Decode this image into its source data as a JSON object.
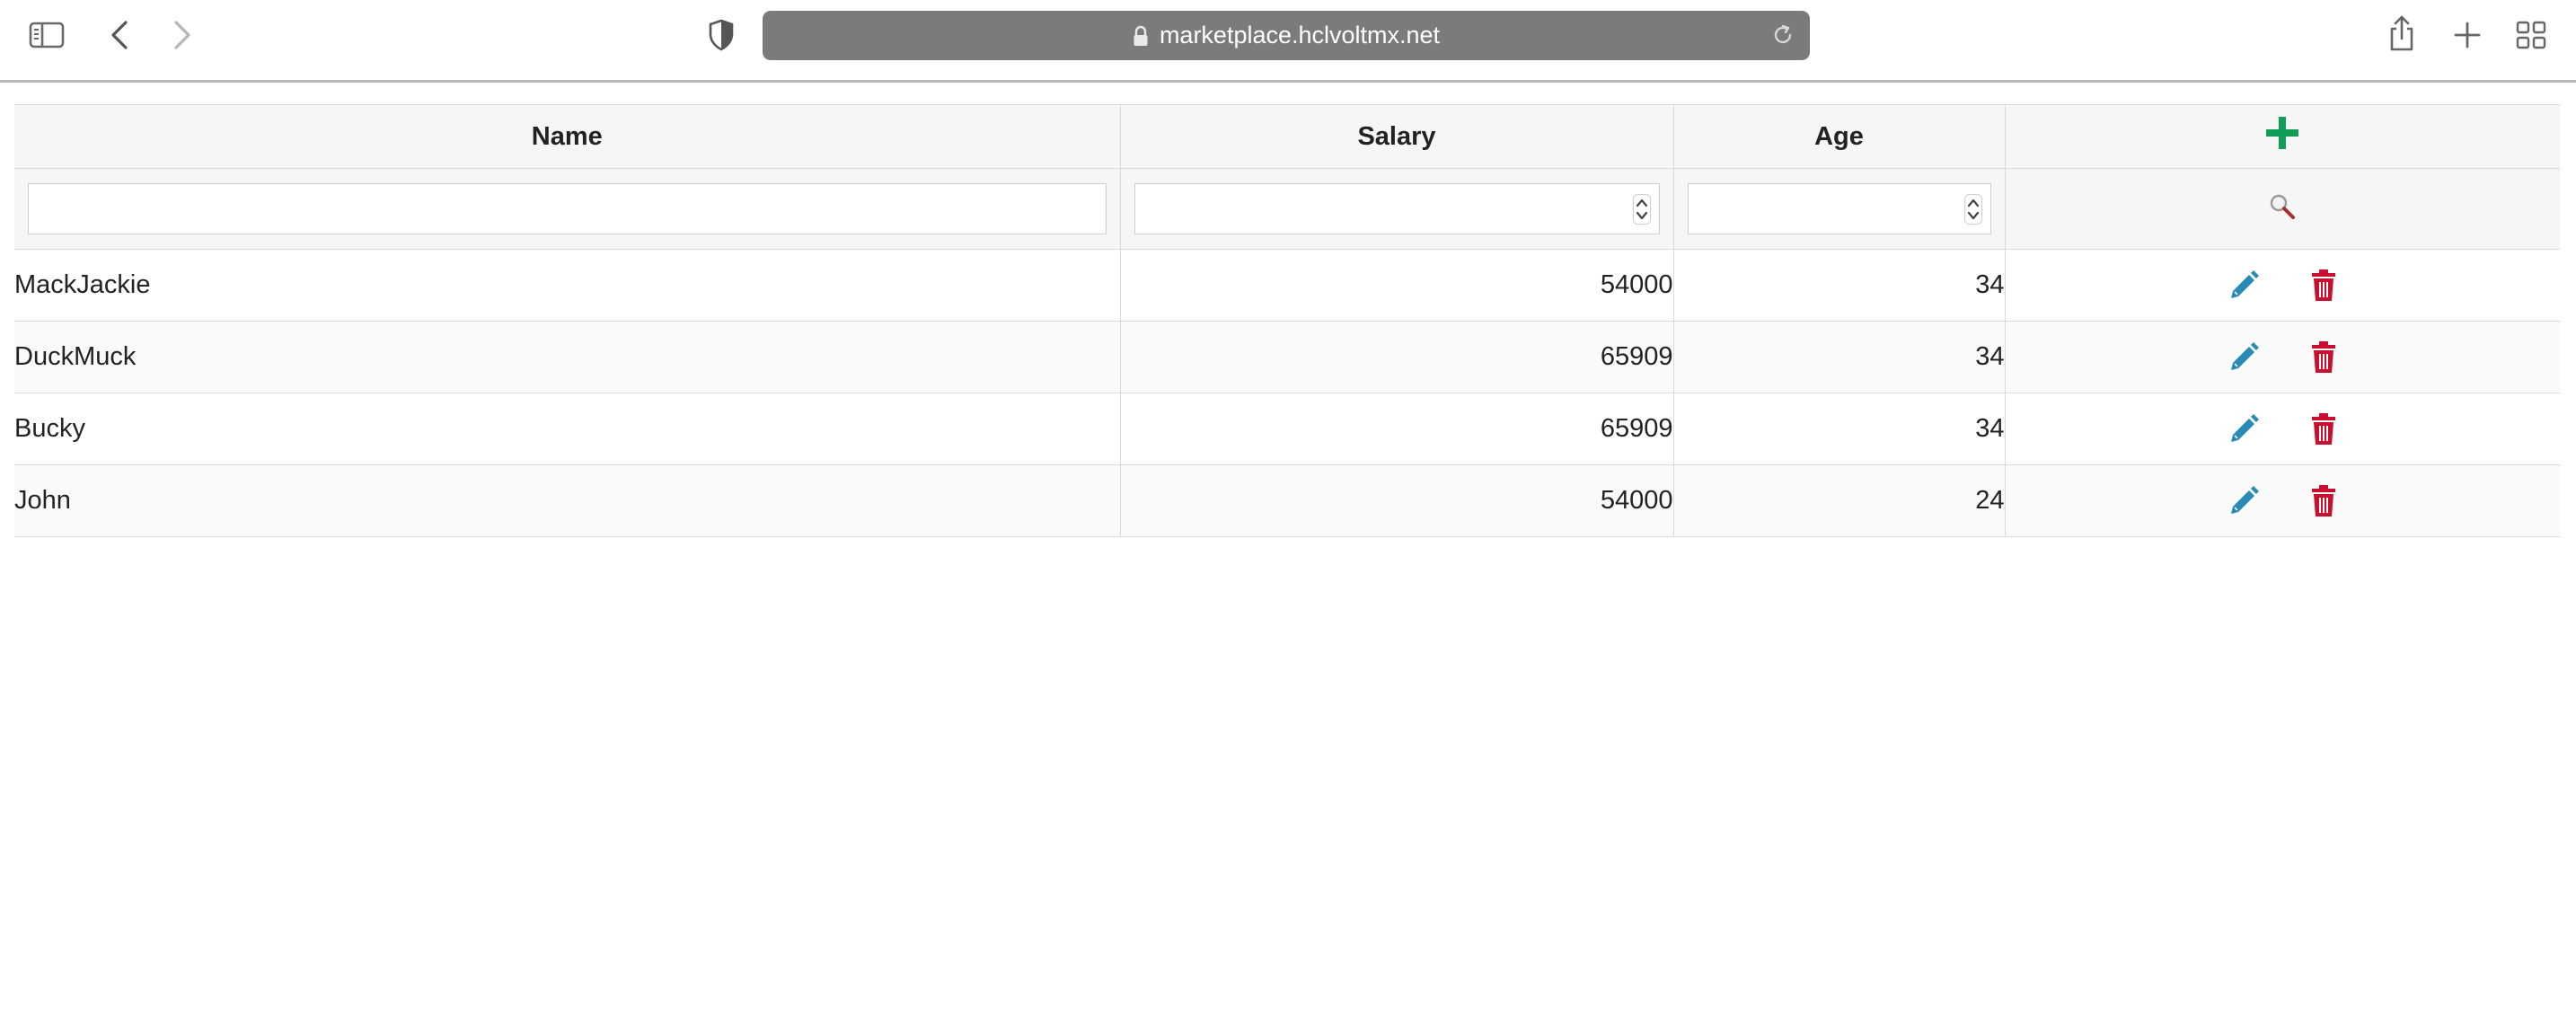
{
  "browser": {
    "url": "marketplace.hclvoltmx.net",
    "icons": [
      "sidebar-icon",
      "back-icon",
      "forward-icon",
      "shield-icon",
      "lock-icon",
      "reload-icon",
      "share-icon",
      "new-tab-icon",
      "tab-overview-icon"
    ]
  },
  "grid": {
    "columns": [
      "Name",
      "Salary",
      "Age"
    ],
    "insert_icon": "plus-icon",
    "search_icon": "magnifier-icon",
    "rows": [
      {
        "name": "MackJackie",
        "salary": "54000",
        "age": "34"
      },
      {
        "name": "DuckMuck",
        "salary": "65909",
        "age": "34"
      },
      {
        "name": "Bucky",
        "salary": "65909",
        "age": "34"
      },
      {
        "name": "John",
        "salary": "54000",
        "age": "24"
      }
    ],
    "row_actions": [
      "edit-icon",
      "delete-icon"
    ]
  },
  "colors": {
    "insert": "#0f9d58",
    "edit": "#2a8ab5",
    "delete": "#c8102e",
    "address_bar": "#7b7b7b"
  }
}
